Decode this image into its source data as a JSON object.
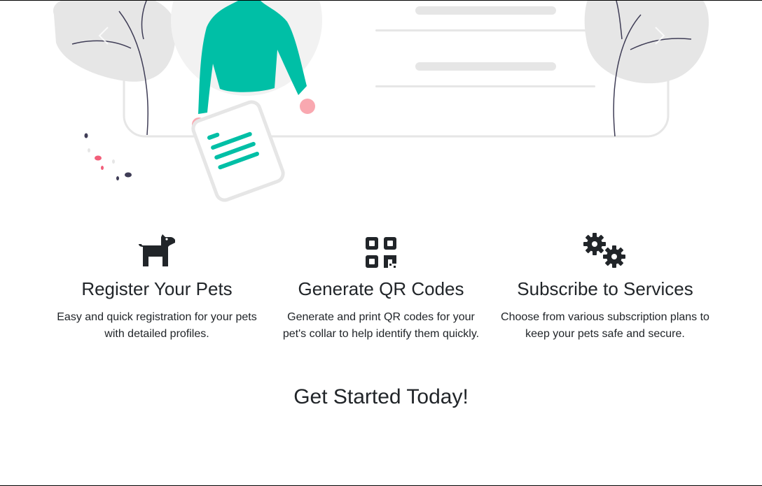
{
  "hero": {
    "prev_label": "‹",
    "next_label": "›"
  },
  "features": [
    {
      "icon": "dog-icon",
      "title": "Register Your Pets",
      "text": "Easy and quick registration for your pets with detailed profiles."
    },
    {
      "icon": "qr-code-icon",
      "title": "Generate QR Codes",
      "text": "Generate and print QR codes for your pet's collar to help identify them quickly."
    },
    {
      "icon": "gears-icon",
      "title": "Subscribe to Services",
      "text": "Choose from various subscription plans to keep your pets safe and secure."
    }
  ],
  "cta": {
    "title": "Get Started Today!"
  },
  "colors": {
    "accent": "#00bfa6",
    "skin": "#f9a8b0",
    "dark": "#2f2e41",
    "gray": "#e6e6e6",
    "text": "#212529"
  }
}
